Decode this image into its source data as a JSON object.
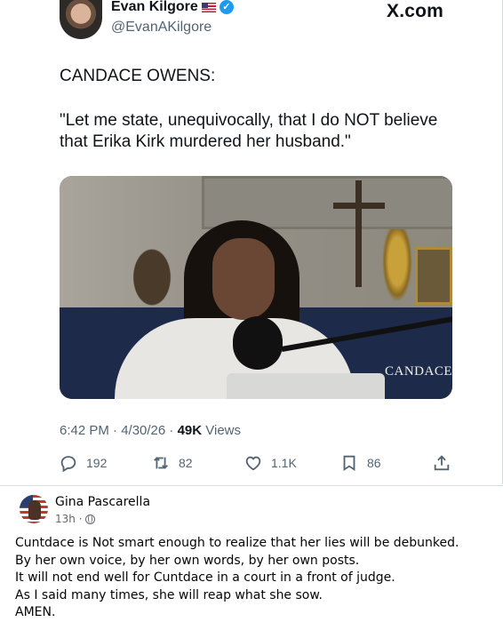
{
  "tweet": {
    "author_name": "Evan Kilgore",
    "author_handle": "@EvanAKilgore",
    "source": "X.com",
    "line1": "CANDACE OWENS:",
    "quote": "\"Let me state, unequivocally, that I do NOT believe that Erika Kirk murdered her husband.\"",
    "media_watermark": "CANDACE",
    "timestamp": "6:42 PM · 4/30/26 · ",
    "views_count": "49K",
    "views_label": " Views",
    "actions": {
      "replies": "192",
      "reposts": "82",
      "likes": "1.1K",
      "bookmarks": "86"
    },
    "icons": [
      "flag-icon",
      "verified-icon",
      "reply-icon",
      "repost-icon",
      "like-icon",
      "bookmark-icon",
      "share-icon"
    ]
  },
  "comment": {
    "author_name": "Gina Pascarella",
    "time": "13h ·",
    "lines": [
      "Cuntdace is Not smart enough to realize that her lies will be debunked.",
      "By her own voice, by her own words, by her own posts.",
      "It will not end well for Cuntdace in a court in a front of judge.",
      "As I said many times, she will reap what she sow.",
      "AMEN."
    ]
  },
  "colors": {
    "text": "#0f1419",
    "muted": "#536471",
    "verified": "#1d9bf0"
  }
}
